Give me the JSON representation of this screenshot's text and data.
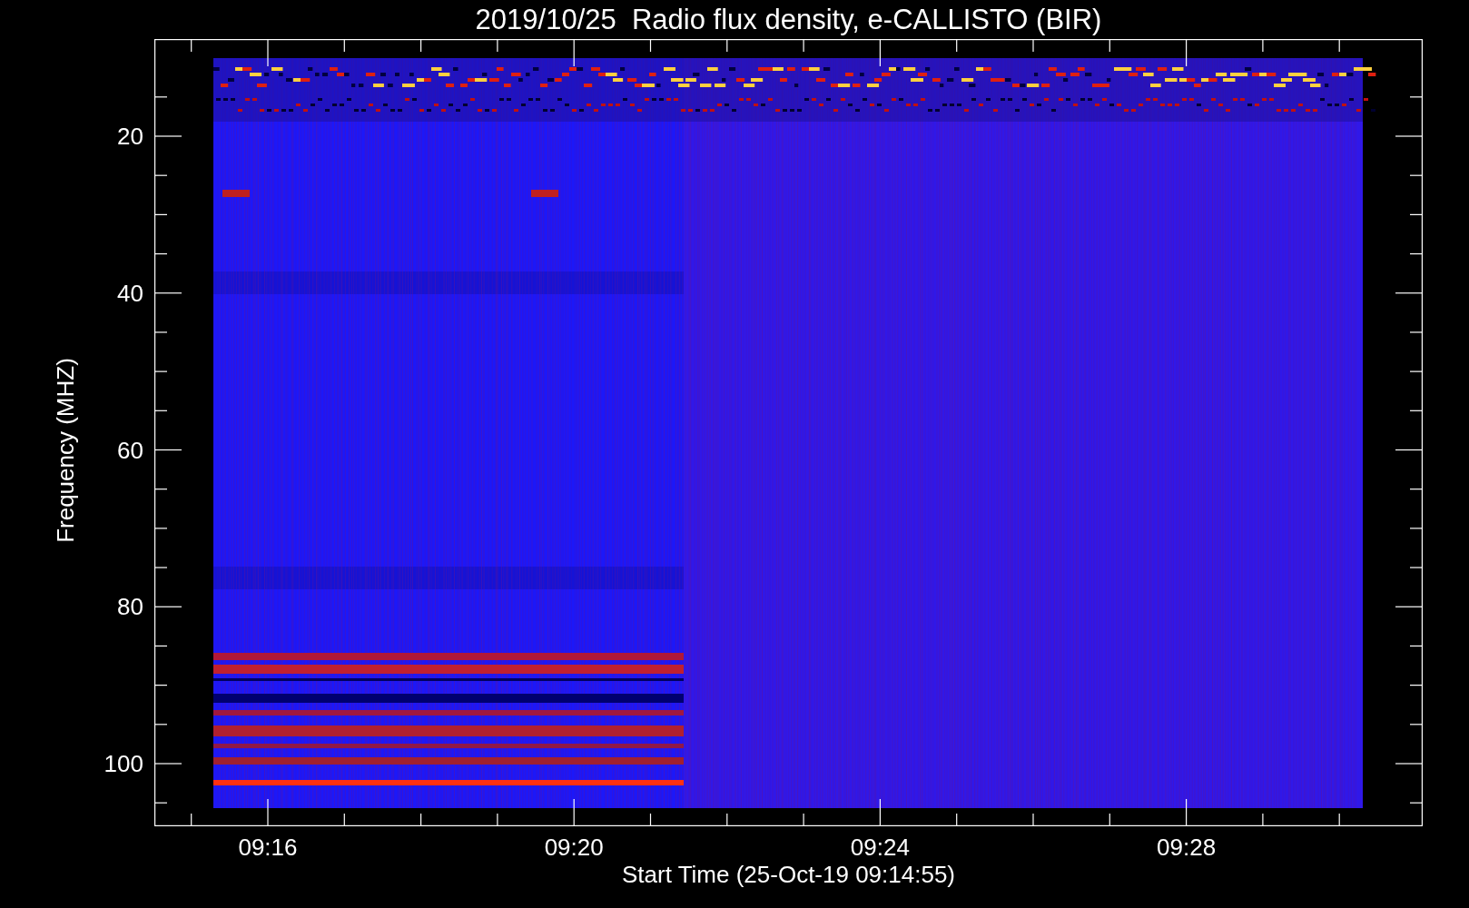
{
  "title": "2019/10/25  Radio flux density, e-CALLISTO (BIR)",
  "y_axis": {
    "label": "Frequency (MHZ)",
    "ticks": [
      "20",
      "40",
      "60",
      "80",
      "100"
    ]
  },
  "x_axis": {
    "label": "Start Time (25-Oct-19 09:14:55)",
    "ticks": [
      "09:16",
      "09:20",
      "09:24",
      "09:28"
    ]
  }
}
